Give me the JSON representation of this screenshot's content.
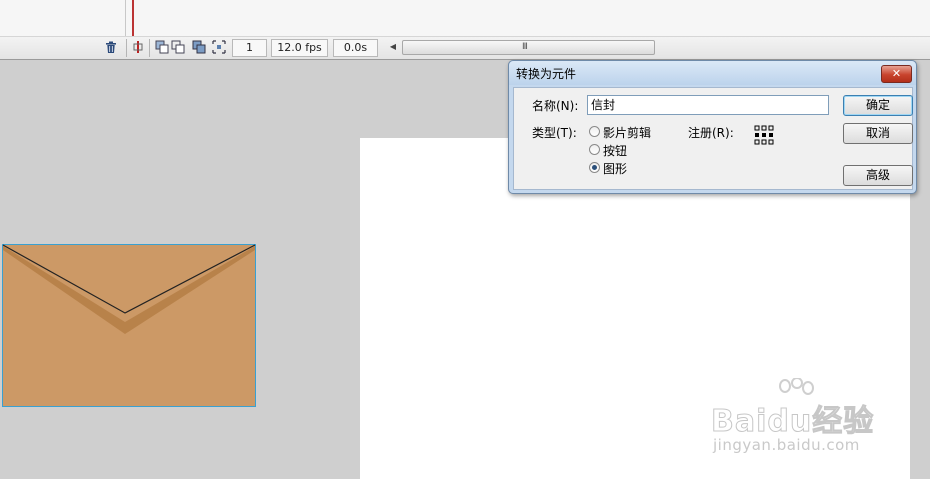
{
  "timeline": {
    "current_frame": "1",
    "frame_rate": "12.0 fps",
    "elapsed_time": "0.0s",
    "scroll_grip": "III"
  },
  "dialog": {
    "title": "转换为元件",
    "name_label": "名称(N):",
    "name_value": "信封",
    "type_label": "类型(T):",
    "type_options": [
      {
        "label": "影片剪辑",
        "selected": false
      },
      {
        "label": "按钮",
        "selected": false
      },
      {
        "label": "图形",
        "selected": true
      }
    ],
    "registration_label": "注册(R):",
    "ok_button": "确定",
    "cancel_button": "取消",
    "advanced_button": "高级",
    "close_glyph": "✕"
  },
  "stage": {
    "envelope_color": "#cc9966",
    "envelope_outline": "#3aa0d0"
  },
  "watermark": {
    "brand": "Baidu经验",
    "url": "jingyan.baidu.com"
  }
}
